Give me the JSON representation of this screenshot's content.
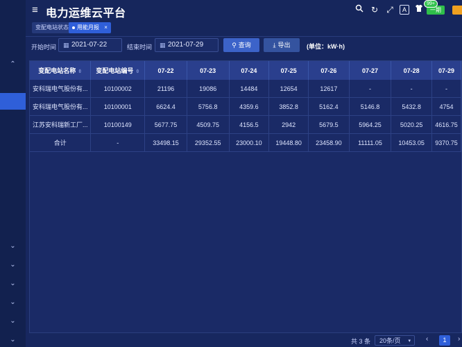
{
  "app": {
    "title": "电力运维云平台"
  },
  "header": {
    "icons": [
      "search-icon",
      "refresh-icon",
      "fullscreen-icon",
      "translate-icon",
      "shirt-icon"
    ],
    "user_label": "一期",
    "notification_count": "99+"
  },
  "tabs": [
    {
      "label": "变配电站状态",
      "active": false
    },
    {
      "label": "用能月报",
      "active": true,
      "close": "×"
    }
  ],
  "filter": {
    "start_label": "开始时间",
    "start_value": "2021-07-22",
    "end_label": "结束时间",
    "end_value": "2021-07-29",
    "query_label": "查询",
    "export_label": "导出",
    "unit_label": "(单位：kW·h)"
  },
  "table": {
    "headers": [
      "变配电站名称",
      "变配电站编号",
      "07-22",
      "07-23",
      "07-24",
      "07-25",
      "07-26",
      "07-27",
      "07-28",
      "07-29"
    ],
    "rows": [
      [
        "安科瑞电气股份有...",
        "10100002",
        "21196",
        "19086",
        "14484",
        "12654",
        "12617",
        "-",
        "-",
        "-"
      ],
      [
        "安科瑞电气股份有...",
        "10100001",
        "6624.4",
        "5756.8",
        "4359.6",
        "3852.8",
        "5162.4",
        "5146.8",
        "5432.8",
        "4754"
      ],
      [
        "江苏安科瑞新工厂...",
        "10100149",
        "5677.75",
        "4509.75",
        "4156.5",
        "2942",
        "5679.5",
        "5964.25",
        "5020.25",
        "4616.75"
      ],
      [
        "合计",
        "-",
        "33498.15",
        "29352.55",
        "23000.10",
        "19448.80",
        "23458.90",
        "11111.05",
        "10453.05",
        "9370.75"
      ]
    ]
  },
  "pagination": {
    "total_text": "共 3 条",
    "page_size": "20条/页",
    "current_page": "1",
    "prev": "‹",
    "next": "›"
  },
  "colors": {
    "background": "#17275f",
    "accent": "#2f5fd9",
    "header_row": "#2a3f8d"
  }
}
